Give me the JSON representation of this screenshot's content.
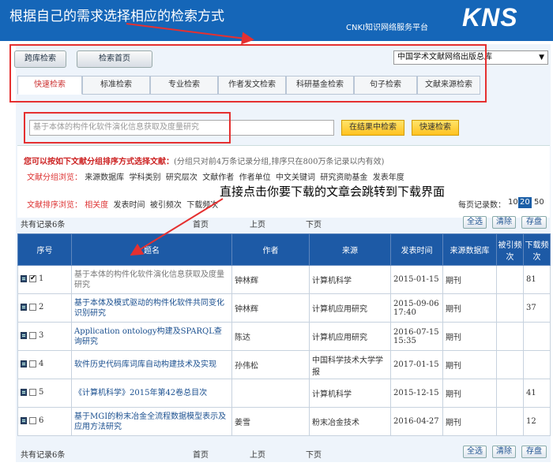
{
  "header": {
    "annotation_title": "根据自己的需求选择相应的检索方式",
    "platform": "CNKI知识网络服务平台",
    "logo": "KNS"
  },
  "top_buttons": {
    "cross_db": "跨库检索",
    "search_home": "检索首页"
  },
  "database_select": {
    "value": "中国学术文献网络出版总库"
  },
  "tabs": [
    "快速检索",
    "标准检索",
    "专业检索",
    "作者发文检索",
    "科研基金检索",
    "句子检索",
    "文献来源检索"
  ],
  "search": {
    "value": "基于本体的构件化软件演化信息获取及度量研究",
    "in_results_button": "在结果中检索",
    "quick_search_button": "快速检索"
  },
  "grouping": {
    "intro_bold": "您可以按如下文献分组排序方式选择文献：",
    "intro_note": "(分组只对前4万条记录分组,排序只在800万条记录以内有效)",
    "group_label": "文献分组浏览：",
    "group_items": [
      "来源数据库",
      "学科类别",
      "研究层次",
      "文献作者",
      "作者单位",
      "中文关键词",
      "研究资助基金",
      "发表年度"
    ],
    "sort_label": "文献排序浏览：",
    "sort_items": [
      "相关度",
      "发表时间",
      "被引频次",
      "下载频次"
    ]
  },
  "annotation_click": "直接点击你要下载的文章会跳转到下载界面",
  "per_page": {
    "label": "每页记录数：",
    "options": [
      "10",
      "20",
      "50"
    ],
    "selected": "20"
  },
  "top_nav": {
    "count": "共有记录6条",
    "first": "首页",
    "prev": "上页",
    "next": "下页"
  },
  "bottom_nav": {
    "count": "共有记录6条",
    "first": "首页",
    "prev": "上页",
    "next": "下页"
  },
  "actions": {
    "select_all": "全选",
    "clear": "清除",
    "save": "存盘"
  },
  "table": {
    "headers": {
      "num": "序号",
      "title": "题名",
      "author": "作者",
      "source": "来源",
      "date": "发表时间",
      "db": "来源数据库",
      "cited": "被引频次",
      "downloads": "下载频次"
    },
    "rows": [
      {
        "num": "1",
        "checked": true,
        "title": "基于本体的构件化软件演化信息获取及度量研究",
        "author": "钟林辉",
        "source": "计算机科学",
        "date": "2015-01-15",
        "db": "期刊",
        "cited": "",
        "downloads": "81"
      },
      {
        "num": "2",
        "checked": false,
        "title": "基于本体及模式驱动的构件化软件共同变化识别研究",
        "author": "钟林辉",
        "source": "计算机应用研究",
        "date": "2015-09-06 17:40",
        "db": "期刊",
        "cited": "",
        "downloads": "37"
      },
      {
        "num": "3",
        "checked": false,
        "title": "Application ontology构建及SPARQL查询研究",
        "author": "陈达",
        "source": "计算机应用研究",
        "date": "2016-07-15 15:35",
        "db": "期刊",
        "cited": "",
        "downloads": ""
      },
      {
        "num": "4",
        "checked": false,
        "title": "软件历史代码库词库自动构建技术及实现",
        "author": "孙伟松",
        "source": "中国科学技术大学学报",
        "date": "2017-01-15",
        "db": "期刊",
        "cited": "",
        "downloads": ""
      },
      {
        "num": "5",
        "checked": false,
        "title": "《计算机科学》2015年第42卷总目次",
        "author": "",
        "source": "计算机科学",
        "date": "2015-12-15",
        "db": "期刊",
        "cited": "",
        "downloads": "41"
      },
      {
        "num": "6",
        "checked": false,
        "title": "基于MGI的粉末冶金全流程数据模型表示及应用方法研究",
        "author": "姜雪",
        "source": "粉末冶金技术",
        "date": "2016-04-27",
        "db": "期刊",
        "cited": "",
        "downloads": "12"
      }
    ]
  },
  "colors": {
    "header_blue": "#1566b8",
    "table_header": "#1d5aa6",
    "annotation_red": "#e53030"
  }
}
